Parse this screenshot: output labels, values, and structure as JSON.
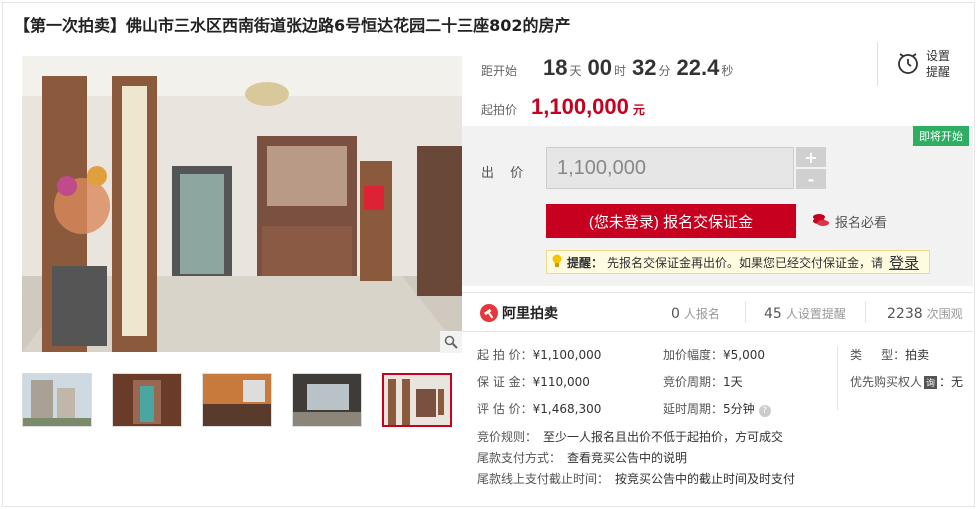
{
  "title": "【第一次拍卖】佛山市三水区西南街道张边路6号恒达花园二十三座802的房产",
  "countdown": {
    "label": "距开始",
    "days": "18",
    "days_unit": "天",
    "hours": "00",
    "hours_unit": "时",
    "minutes": "32",
    "minutes_unit": "分",
    "seconds": "22.4",
    "seconds_unit": "秒"
  },
  "remind": {
    "label": "设置提醒"
  },
  "start_price": {
    "label": "起拍价",
    "value": "1,100,000",
    "unit": "元"
  },
  "badge": "即将开始",
  "bid": {
    "label": "出 价",
    "value": "1,100,000",
    "plus": "+",
    "minus": "-"
  },
  "signup_button": "(您未登录) 报名交保证金",
  "must_read": "报名必看",
  "tip": {
    "prefix": "提醒：",
    "text": "先报名交保证金再出价。如果您已经交付保证金，请",
    "login": "登录"
  },
  "stats": {
    "brand": "阿里拍卖",
    "signups": "0",
    "signups_label": "人报名",
    "reminders": "45",
    "reminders_label": "人设置提醒",
    "views": "2238",
    "views_label": "次围观"
  },
  "details": {
    "start_price_k": "起 拍 价：",
    "start_price_v": "¥1,100,000",
    "deposit_k": "保 证 金：",
    "deposit_v": "¥110,000",
    "appraisal_k": "评 估 价：",
    "appraisal_v": "¥1,468,300",
    "increment_k": "加价幅度：",
    "increment_v": "¥5,000",
    "cycle_k": "竞价周期：",
    "cycle_v": "1天",
    "extend_k": "延时周期：",
    "extend_v": "5分钟",
    "type_k": "类     型：",
    "type_v": "拍卖",
    "priority_k": "优先购买权人",
    "priority_icon": "询",
    "priority_v": "：无",
    "rule_k": "竞价规则：",
    "rule_v": "至少一人报名且出价不低于起拍价，方可成交",
    "pay_k": "尾款支付方式：",
    "pay_v": "查看竞买公告中的说明",
    "deadline_k": "尾款线上支付截止时间：",
    "deadline_v": "按竞买公告中的截止时间及时支付"
  },
  "colors": {
    "accent": "#c6001e",
    "badge": "#2eae62"
  }
}
